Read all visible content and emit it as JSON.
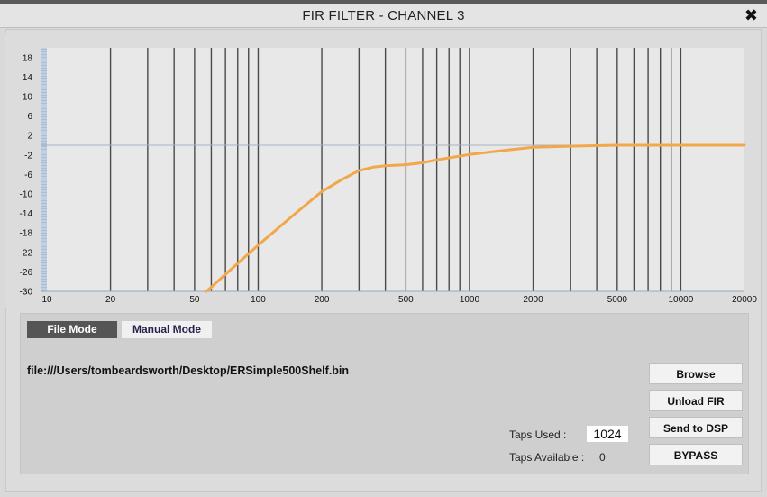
{
  "window": {
    "title": "FIR FILTER - CHANNEL 3",
    "close_glyph": "✖"
  },
  "colors": {
    "plot_bg": "#e8e8e8",
    "curve": "#f2a74a",
    "vline": "#4a4a4a",
    "zero_line": "#a8b4c4",
    "panel_bg": "#cfcfcf"
  },
  "chart_data": {
    "type": "line",
    "xscale": "log",
    "xlim": [
      10,
      20000
    ],
    "ylim": [
      -30,
      20
    ],
    "x_ticks": [
      10,
      20,
      50,
      100,
      200,
      500,
      1000,
      2000,
      5000,
      10000,
      20000
    ],
    "y_ticks": [
      18,
      14,
      10,
      6,
      2,
      -2,
      -6,
      -10,
      -14,
      -18,
      -22,
      -26,
      -30
    ],
    "reference_line_y": 0,
    "grid_vlines_hz": [
      20,
      30,
      40,
      50,
      60,
      70,
      80,
      90,
      100,
      200,
      300,
      400,
      500,
      600,
      700,
      800,
      900,
      1000,
      2000,
      3000,
      4000,
      5000,
      6000,
      7000,
      8000,
      9000,
      10000
    ],
    "series": [
      {
        "x": [
          57,
          70,
          100,
          150,
          200,
          250,
          300,
          350,
          400,
          500,
          600,
          700,
          800,
          1000,
          1500,
          2000,
          3000,
          5000,
          10000,
          20000
        ],
        "y": [
          -30,
          -26.5,
          -20.5,
          -14,
          -9.5,
          -7,
          -5.2,
          -4.5,
          -4.2,
          -4.0,
          -3.6,
          -3.0,
          -2.6,
          -1.9,
          -1.0,
          -0.4,
          -0.2,
          0,
          0,
          0
        ]
      }
    ]
  },
  "tabs": {
    "file_mode": "File Mode",
    "manual_mode": "Manual Mode"
  },
  "file": {
    "path": "file:///Users/tombeardsworth/Desktop/ERSimple500Shelf.bin"
  },
  "buttons": {
    "browse": "Browse",
    "unload": "Unload FIR",
    "send": "Send to DSP",
    "bypass": "BYPASS"
  },
  "taps": {
    "used_label": "Taps Used :",
    "used_value": "1024",
    "available_label": "Taps Available :",
    "available_value": "0"
  }
}
